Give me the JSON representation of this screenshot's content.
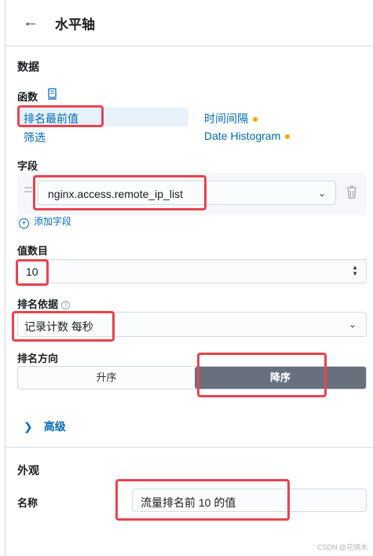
{
  "header": {
    "title": "水平轴",
    "back_icon": "arrow-left-icon"
  },
  "data_section": {
    "title": "数据",
    "function_label": "函数",
    "function_icon": "documentation-icon",
    "functions": [
      {
        "label": "排名最前值",
        "selected": true
      },
      {
        "label": "筛选",
        "selected": false
      },
      {
        "label": "时间间隔",
        "selected": false,
        "status_color": "#f5a700"
      },
      {
        "label": "Date Histogram",
        "selected": false,
        "status_color": "#f5a700"
      }
    ],
    "field_label": "字段",
    "field_value": "nginx.access.remote_ip_list",
    "add_field": "添加字段",
    "count_label": "值数目",
    "count_value": "10",
    "rank_by_label": "排名依据",
    "rank_by_value": "记录计数 每秒",
    "direction_label": "排名方向",
    "direction_options": [
      "升序",
      "降序"
    ],
    "direction_selected": "降序",
    "advanced": "高级"
  },
  "appearance": {
    "title": "外观",
    "name_label": "名称",
    "name_value": "流量排名前 10  的值"
  },
  "watermark": "CSDN @花晓木",
  "colors": {
    "accent": "#006bb8",
    "highlight": "#e8444f",
    "selected_bg": "#e6f1fa",
    "toggle_selected": "#69707d"
  }
}
